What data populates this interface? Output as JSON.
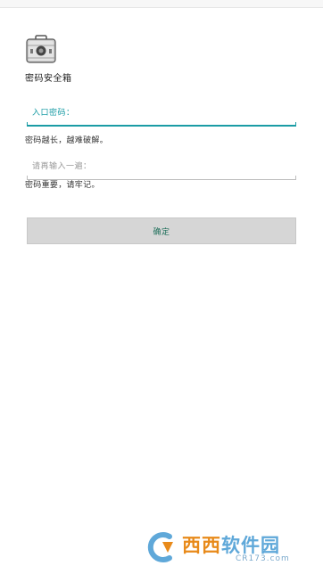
{
  "app": {
    "title": "密码安全箱",
    "icon": "safe-box-icon"
  },
  "form": {
    "password_placeholder": "入口密码：",
    "password_hint": "密码越长，越难破解。",
    "confirm_placeholder": "请再输入一遍：",
    "confirm_hint": "密码重要，请牢记。",
    "confirm_button": "确定"
  },
  "watermark": {
    "name_part1": "西西",
    "name_part2": "软件园",
    "domain": "CR173.com",
    "icon": "cr-logo-icon"
  },
  "colors": {
    "accent": "#1a9ca5",
    "button_bg": "#d6d6d6",
    "button_text": "#1e6f5a"
  }
}
